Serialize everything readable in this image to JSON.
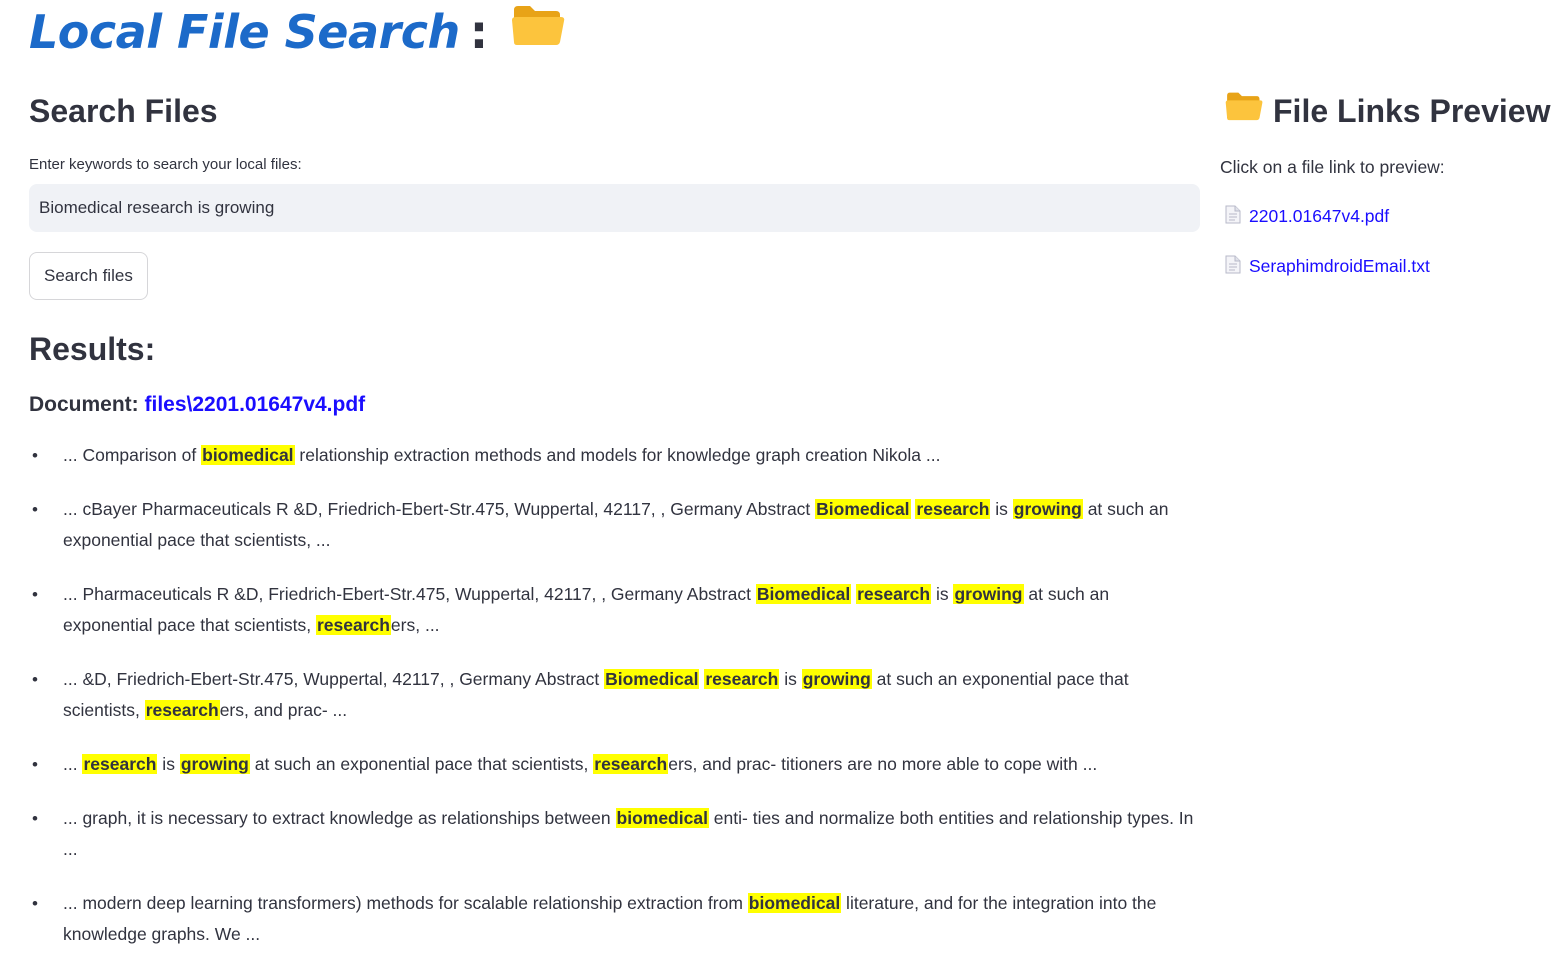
{
  "header": {
    "title": "Local File Search",
    "colon": ":",
    "icon": "open-folder-icon"
  },
  "search": {
    "heading": "Search Files",
    "label": "Enter keywords to search your local files:",
    "value": "Biomedical research is growing",
    "button": "Search files"
  },
  "results": {
    "heading": "Results:",
    "doc_prefix": "Document:",
    "doc_path": "files\\2201.01647v4.pdf",
    "snippets": [
      [
        {
          "t": "... Comparison of "
        },
        {
          "h": "biomedical"
        },
        {
          "t": " relationship extraction methods and models for knowledge graph creation Nikola ..."
        }
      ],
      [
        {
          "t": "... cBayer Pharmaceuticals R &D, Friedrich-Ebert-Str.475, Wuppertal, 42117, , Germany Abstract "
        },
        {
          "h": "Biomedical"
        },
        {
          "t": " "
        },
        {
          "h": "research"
        },
        {
          "t": " is "
        },
        {
          "h": "growing"
        },
        {
          "t": " at such an exponential pace that scientists, ..."
        }
      ],
      [
        {
          "t": "... Pharmaceuticals R &D, Friedrich-Ebert-Str.475, Wuppertal, 42117, , Germany Abstract "
        },
        {
          "h": "Biomedical"
        },
        {
          "t": " "
        },
        {
          "h": "research"
        },
        {
          "t": " is "
        },
        {
          "h": "growing"
        },
        {
          "t": " at such an exponential pace that scientists, "
        },
        {
          "h": "research"
        },
        {
          "t": "ers, ..."
        }
      ],
      [
        {
          "t": "... &D, Friedrich-Ebert-Str.475, Wuppertal, 42117, , Germany Abstract "
        },
        {
          "h": "Biomedical"
        },
        {
          "t": " "
        },
        {
          "h": "research"
        },
        {
          "t": " is "
        },
        {
          "h": "growing"
        },
        {
          "t": " at such an exponential pace that scientists, "
        },
        {
          "h": "research"
        },
        {
          "t": "ers, and prac- ..."
        }
      ],
      [
        {
          "t": "... "
        },
        {
          "h": "research"
        },
        {
          "t": " is "
        },
        {
          "h": "growing"
        },
        {
          "t": " at such an exponential pace that scientists, "
        },
        {
          "h": "research"
        },
        {
          "t": "ers, and prac- titioners are no more able to cope with ..."
        }
      ],
      [
        {
          "t": "... graph, it is necessary to extract knowledge as relationships between "
        },
        {
          "h": "biomedical"
        },
        {
          "t": " enti- ties and normalize both entities and relationship types. In ..."
        }
      ],
      [
        {
          "t": "... modern deep learning transformers) methods for scalable relationship extraction from "
        },
        {
          "h": "biomedical"
        },
        {
          "t": " literature, and for the integration into the knowledge graphs. We ..."
        }
      ]
    ]
  },
  "sidebar": {
    "title": "File Links Preview",
    "icon": "open-folder-icon",
    "hint": "Click on a file link to preview:",
    "files": [
      {
        "name": "2201.01647v4.pdf",
        "icon": "document-icon"
      },
      {
        "name": "SeraphimdroidEmail.txt",
        "icon": "document-icon"
      }
    ]
  },
  "colors": {
    "title": "#1c6ac9",
    "link": "#1a0dff",
    "highlight": "#ffff00",
    "input_bg": "#f0f2f6",
    "text": "#31333f"
  }
}
